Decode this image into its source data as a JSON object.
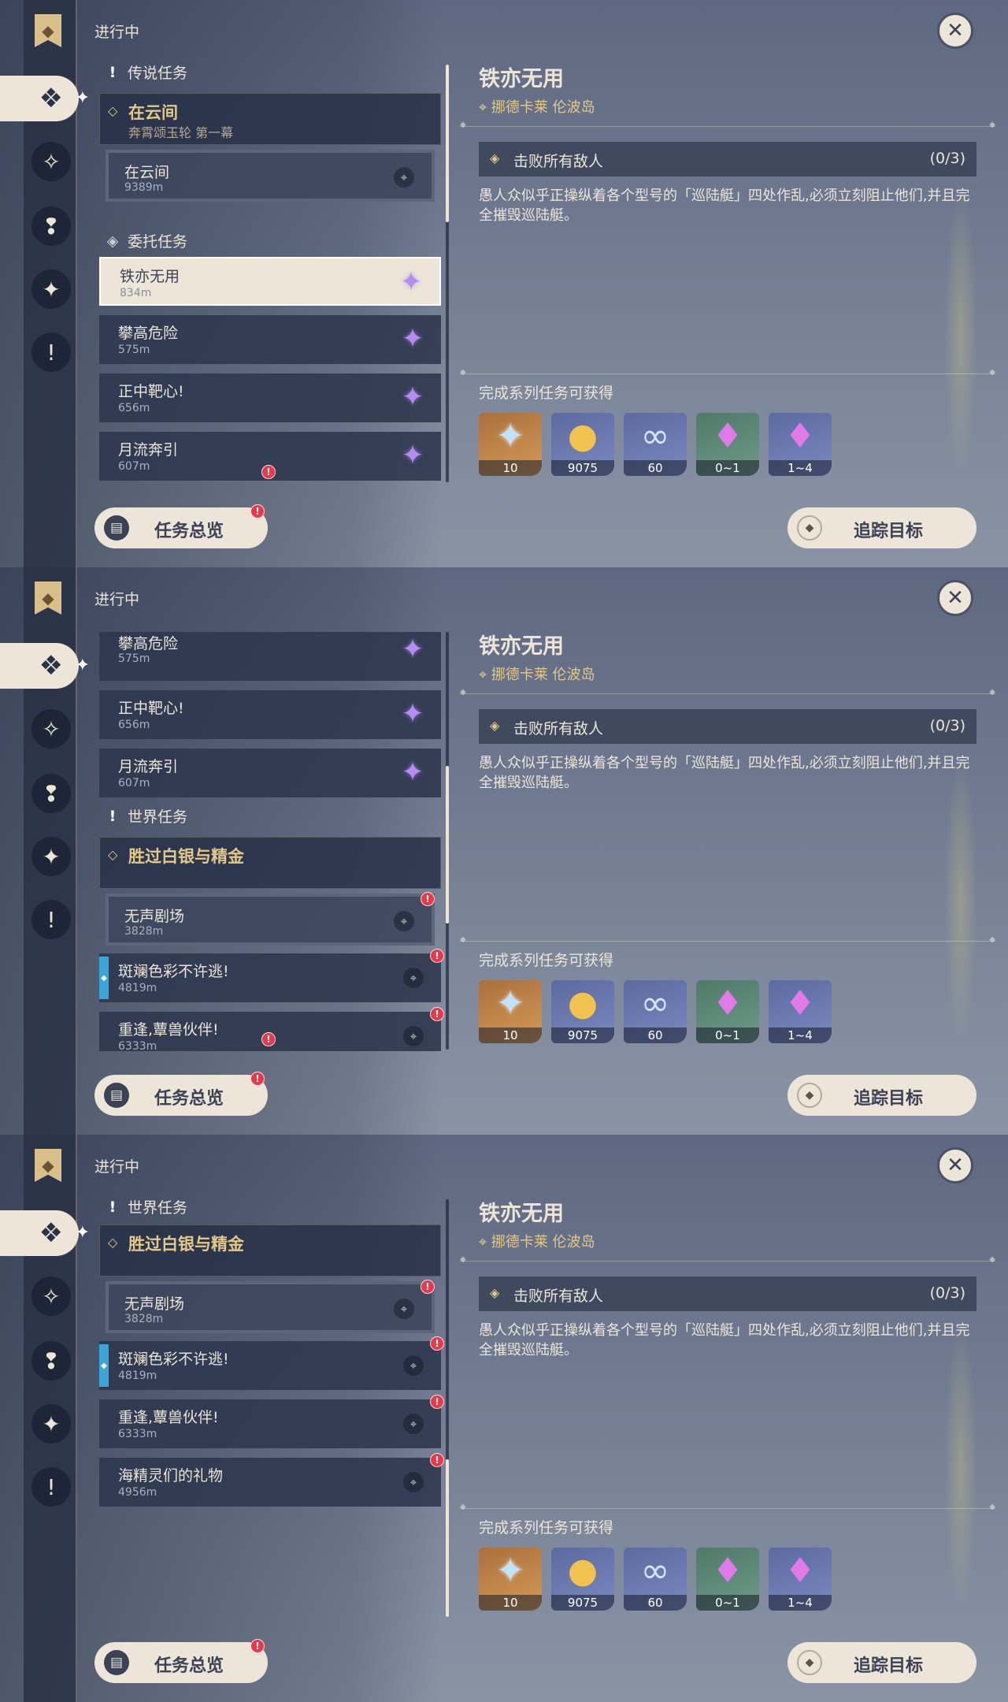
{
  "panels": [
    {
      "top_label": "进行中",
      "sections": [
        {
          "header": "传说任务"
        },
        {
          "header": "委托任务"
        }
      ],
      "legend_group": {
        "title": "在云间",
        "subtitle": "奔霄颂玉轮 第一幕"
      },
      "legend_item": {
        "title": "在云间",
        "distance": "9389m"
      },
      "commissions": [
        {
          "title": "铁亦无用",
          "distance": "834m"
        },
        {
          "title": "攀高危险",
          "distance": "575m"
        },
        {
          "title": "正中靶心!",
          "distance": "656m"
        },
        {
          "title": "月流奔引",
          "distance": "607m"
        }
      ]
    },
    {
      "top_label": "进行中",
      "commissions": [
        {
          "title": "攀高危险",
          "distance": "575m"
        },
        {
          "title": "正中靶心!",
          "distance": "656m"
        },
        {
          "title": "月流奔引",
          "distance": "607m"
        }
      ],
      "world_header": "世界任务",
      "world_group": {
        "title": "胜过白银与精金"
      },
      "world_sub": {
        "title": "无声剧场",
        "distance": "3828m"
      },
      "world_items": [
        {
          "title": "斑斓色彩不许逃!",
          "distance": "4819m"
        },
        {
          "title": "重逢,蕈兽伙伴!",
          "distance": "6333m"
        }
      ]
    },
    {
      "top_label": "进行中",
      "world_header": "世界任务",
      "world_group": {
        "title": "胜过白银与精金"
      },
      "world_sub": {
        "title": "无声剧场",
        "distance": "3828m"
      },
      "world_items": [
        {
          "title": "斑斓色彩不许逃!",
          "distance": "4819m"
        },
        {
          "title": "重逢,蕈兽伙伴!",
          "distance": "6333m"
        },
        {
          "title": "海精灵们的礼物",
          "distance": "4956m"
        }
      ]
    }
  ],
  "detail": {
    "title": "铁亦无用",
    "location": "挪德卡莱 伦波岛",
    "objective": "击败所有敌人",
    "objective_count": "(0/3)",
    "description": "愚人众似乎正操纵着各个型号的「巡陆艇」四处作乱,必须立刻阻止他们,并且完全摧毁巡陆艇。",
    "rewards_label": "完成系列任务可获得",
    "rewards": [
      {
        "icon": "primogem-icon",
        "glyph": "✦",
        "count": "10"
      },
      {
        "icon": "mora-icon",
        "glyph": "●",
        "count": "9075"
      },
      {
        "icon": "adventure-exp-icon",
        "glyph": "∞",
        "count": "60"
      },
      {
        "icon": "crystal-chunk-icon",
        "glyph": "♦",
        "count": "0~1"
      },
      {
        "icon": "crystal-cluster-icon",
        "glyph": "♦",
        "count": "1~4"
      }
    ]
  },
  "buttons": {
    "overview": "任务总览",
    "track": "追踪目标"
  },
  "colors": {
    "accent_gold": "#e4c88a",
    "cream": "#ece5d8",
    "alert_red": "#e8384b",
    "commission_purple": "#b58cf3",
    "world_blue": "#3aa6d8"
  }
}
